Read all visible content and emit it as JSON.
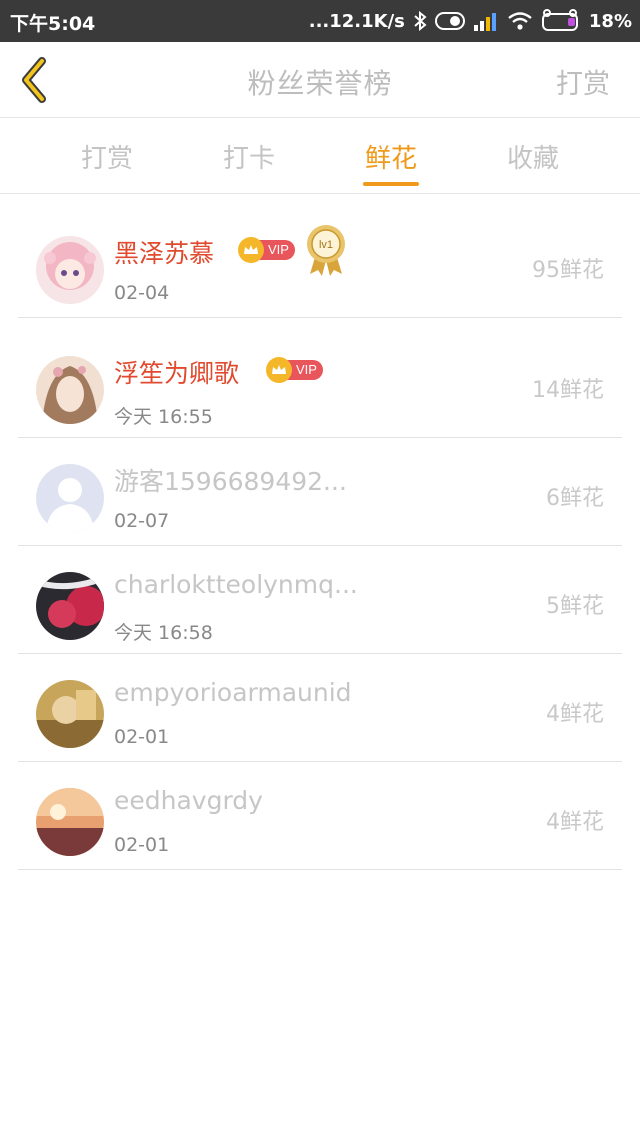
{
  "status_bar": {
    "time": "下午5:04",
    "network_speed": "...12.1K/s",
    "battery": "18%"
  },
  "header": {
    "title": "粉丝荣誉榜",
    "right_action": "打赏"
  },
  "tabs": [
    {
      "label": "打赏",
      "active": false
    },
    {
      "label": "打卡",
      "active": false
    },
    {
      "label": "鲜花",
      "active": true
    },
    {
      "label": "收藏",
      "active": false
    }
  ],
  "fans": [
    {
      "name": "黑泽苏慕",
      "date": "02-04",
      "count": "95鲜花",
      "vip": true,
      "vip_label": "VIP",
      "level": "lv1"
    },
    {
      "name": "浮笙为卿歌",
      "date": "今天 16:55",
      "count": "14鲜花",
      "vip": true,
      "vip_label": "VIP"
    },
    {
      "name": "游客1596689492...",
      "date": "02-07",
      "count": "6鲜花",
      "vip": false
    },
    {
      "name": "charloktteolynmq...",
      "date": "今天 16:58",
      "count": "5鲜花",
      "vip": false
    },
    {
      "name": "empyorioarmaunid",
      "date": "02-01",
      "count": "4鲜花",
      "vip": false
    },
    {
      "name": "eedhavgrdy",
      "date": "02-01",
      "count": "4鲜花",
      "vip": false
    }
  ],
  "colors": {
    "accent": "#ef9a1a",
    "vip_name": "#e14a2f",
    "status_bar": "#3a3a3a"
  }
}
